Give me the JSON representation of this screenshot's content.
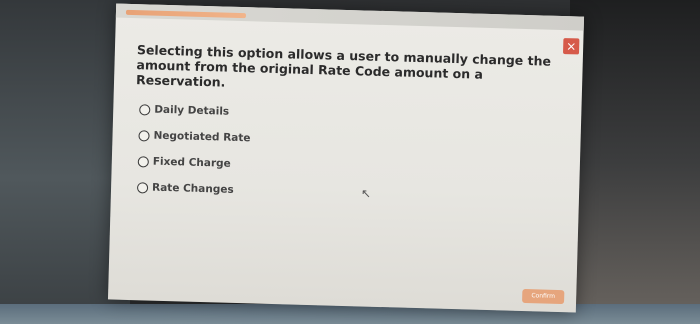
{
  "dialog": {
    "question": "Selecting this option allows a user to manually change the amount from the original Rate Code amount on a Reservation.",
    "close_label": "×",
    "confirm_label": "Confirm",
    "options": [
      {
        "label": "Daily Details"
      },
      {
        "label": "Negotiated Rate"
      },
      {
        "label": "Fixed Charge"
      },
      {
        "label": "Rate Changes"
      }
    ]
  },
  "icons": {
    "close": "close-icon",
    "cursor": "mouse-cursor-icon",
    "radio": "radio-button-icon"
  },
  "colors": {
    "accent": "#e8a276",
    "close": "#d65a4a",
    "dialog_background": "#e9e8e3"
  }
}
